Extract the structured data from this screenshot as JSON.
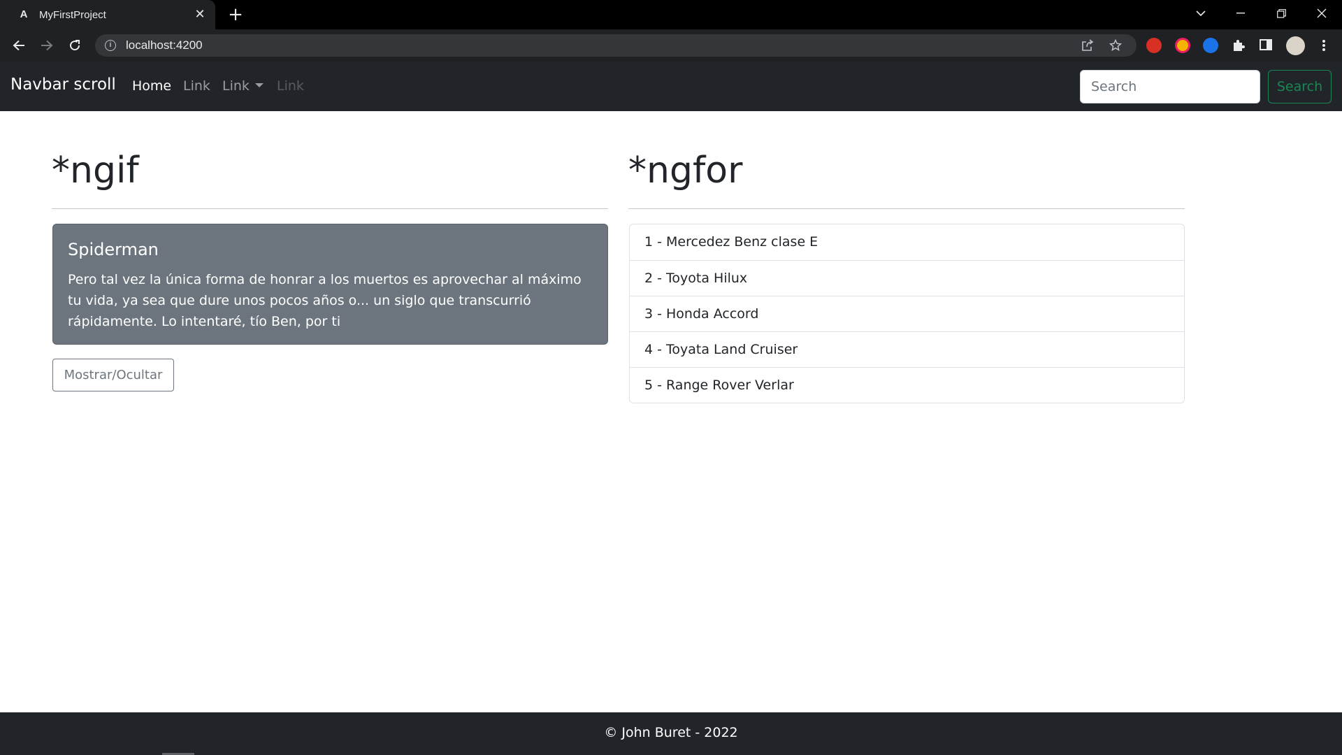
{
  "browser": {
    "tab_title": "MyFirstProject",
    "favicon": "angular-logo",
    "url": "localhost:4200",
    "extension_icons": [
      "red-hand-extension-icon",
      "yellow-pink-extension-icon",
      "blue-s-extension-icon",
      "puzzle-icon"
    ]
  },
  "navbar": {
    "brand": "Navbar scroll",
    "links": [
      {
        "label": "Home",
        "state": "active"
      },
      {
        "label": "Link",
        "state": "normal"
      },
      {
        "label": "Link",
        "state": "dropdown"
      },
      {
        "label": "Link",
        "state": "disabled"
      }
    ],
    "search_placeholder": "Search",
    "search_button": "Search"
  },
  "ngif": {
    "title": "*ngif",
    "alert_title": "Spiderman",
    "alert_text": "Pero tal vez la única forma de honrar a los muertos es aprovechar al máximo tu vida, ya sea que dure unos pocos años o... un siglo que transcurrió rápidamente. Lo intentaré, tío Ben, por ti",
    "toggle_button": "Mostrar/Ocultar"
  },
  "ngfor": {
    "title": "*ngfor",
    "items": [
      "1 - Mercedez Benz clase E",
      "2 - Toyota Hilux",
      "3 - Honda Accord",
      "4 - Toyata Land Cruiser",
      "5 - Range Rover Verlar"
    ]
  },
  "footer": {
    "text": "© John Buret - 2022"
  },
  "colors": {
    "navbar_bg": "#212529",
    "alert_bg": "#6c757d",
    "success": "#198754"
  }
}
